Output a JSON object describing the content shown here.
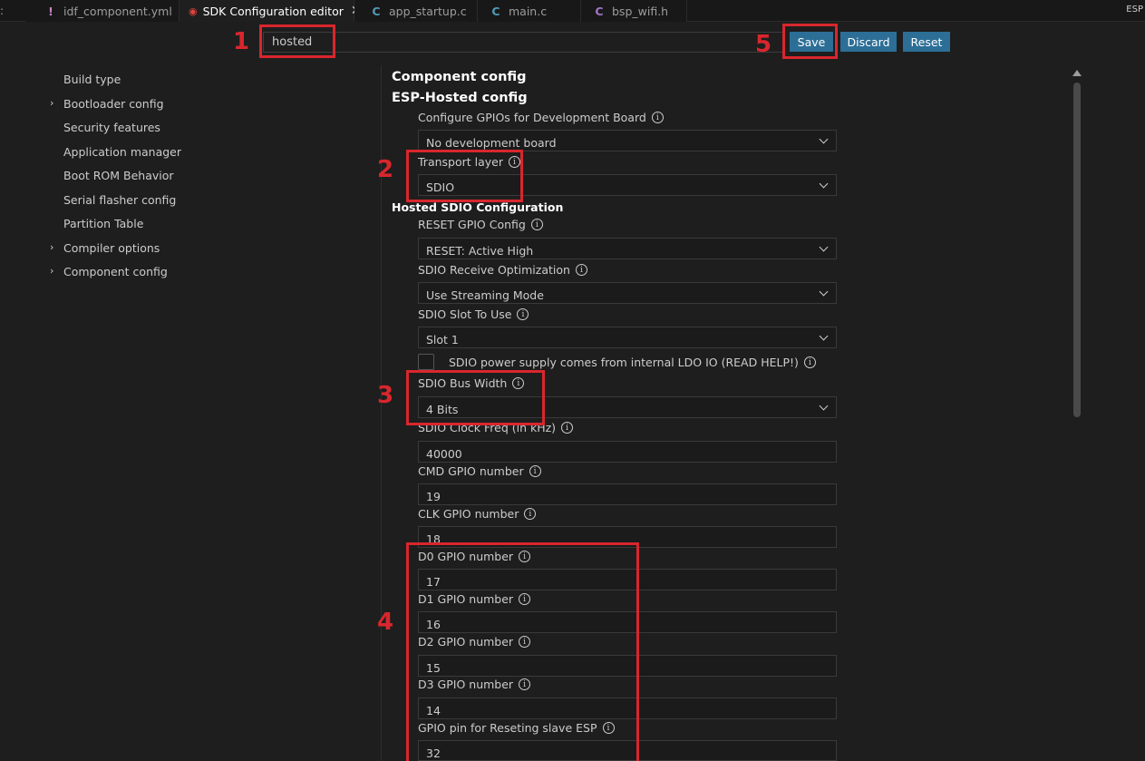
{
  "tabs": {
    "edge_left": ":",
    "items": [
      {
        "label": "idf_component.yml",
        "icon": "yml-file-icon",
        "glyph": "!"
      },
      {
        "label": "SDK Configuration editor",
        "icon": "espressif-icon",
        "glyph": "◉",
        "active": true
      },
      {
        "label": "app_startup.c",
        "icon": "c-file-icon",
        "glyph": "C"
      },
      {
        "label": "main.c",
        "icon": "c-file-icon",
        "glyph": "C"
      },
      {
        "label": "bsp_wifi.h",
        "icon": "h-file-icon",
        "glyph": "C"
      }
    ],
    "close_glyph": "✕",
    "right_text": "ESP"
  },
  "search": {
    "value": "hosted"
  },
  "toolbar": {
    "save_label": "Save",
    "discard_label": "Discard",
    "reset_label": "Reset",
    "button_color": "#2c6e96"
  },
  "sidebar": {
    "items": [
      {
        "label": "Build type",
        "expandable": false
      },
      {
        "label": "Bootloader config",
        "expandable": true
      },
      {
        "label": "Security features",
        "expandable": false
      },
      {
        "label": "Application manager",
        "expandable": false
      },
      {
        "label": "Boot ROM Behavior",
        "expandable": false
      },
      {
        "label": "Serial flasher config",
        "expandable": false
      },
      {
        "label": "Partition Table",
        "expandable": false
      },
      {
        "label": "Compiler options",
        "expandable": true
      },
      {
        "label": "Component config",
        "expandable": true
      }
    ],
    "chevron_glyph": "›"
  },
  "main": {
    "heading": "Component config",
    "subheading": "ESP-Hosted config",
    "sdio_heading": "Hosted SDIO Configuration",
    "info_glyph": "i",
    "settings": {
      "dev_board_label": "Configure GPIOs for Development Board",
      "dev_board_value": "No development board",
      "transport_label": "Transport layer",
      "transport_value": "SDIO",
      "reset_cfg_label": "RESET GPIO Config",
      "reset_cfg_value": "RESET: Active High",
      "rx_opt_label": "SDIO Receive Optimization",
      "rx_opt_value": "Use Streaming Mode",
      "slot_label": "SDIO Slot To Use",
      "slot_value": "Slot 1",
      "ldo_label": "SDIO power supply comes from internal LDO IO (READ HELP!)",
      "ldo_checked": false,
      "bus_width_label": "SDIO Bus Width",
      "bus_width_value": "4 Bits",
      "clock_label": "SDIO Clock Freq (in kHz)",
      "clock_value": "40000",
      "cmd_label": "CMD GPIO number",
      "cmd_value": "19",
      "clk_label": "CLK GPIO number",
      "clk_value": "18",
      "d0_label": "D0 GPIO number",
      "d0_value": "17",
      "d1_label": "D1 GPIO number",
      "d1_value": "16",
      "d2_label": "D2 GPIO number",
      "d2_value": "15",
      "d3_label": "D3 GPIO number",
      "d3_value": "14",
      "reset_pin_label": "GPIO pin for Reseting slave ESP",
      "reset_pin_value": "32"
    }
  },
  "annotations": {
    "n1": "1",
    "n2": "2",
    "n3": "3",
    "n4": "4",
    "n5": "5",
    "color": "#d9262d"
  }
}
